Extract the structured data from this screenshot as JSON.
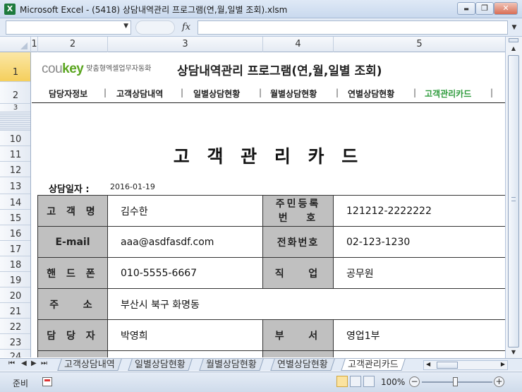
{
  "window": {
    "title": "Microsoft Excel - (5418) 상담내역관리 프로그램(연,월,일별 조회).xlsm",
    "app_icon": "excel-icon",
    "minimize_glyph": "▬",
    "restore_glyph": "❐",
    "close_glyph": "✕"
  },
  "formula_bar": {
    "name_box_value": "",
    "fx_label": "fx",
    "formula_value": ""
  },
  "columns": [
    "1",
    "2",
    "3",
    "4",
    "5"
  ],
  "rows": [
    "1",
    "2",
    "3",
    "10",
    "11",
    "12",
    "13",
    "14",
    "15",
    "16",
    "17",
    "18",
    "19",
    "20",
    "21",
    "22",
    "23",
    "24"
  ],
  "header": {
    "logo_cou": "cou",
    "logo_key": "key",
    "logo_tagline": "맞춤형엑셀업무자동화",
    "program_title": "상담내역관리 프로그램(연,월,일별 조회)"
  },
  "nav": {
    "items": [
      {
        "label": "담당자정보"
      },
      {
        "label": "고객상담내역"
      },
      {
        "label": "일별상담현황"
      },
      {
        "label": "월별상담현황"
      },
      {
        "label": "연별상담현황"
      },
      {
        "label": "고객관리카드"
      }
    ],
    "separator": "|",
    "current_index": 5
  },
  "card": {
    "title": "고 객 관 리 카 드",
    "date_label": "상담일자 :",
    "date_value": "2016-01-19",
    "rows": [
      {
        "l1": "고 객 명",
        "v1": "김수한",
        "l2a": "주민등록",
        "l2b": "번   호",
        "v2": "121212-2222222"
      },
      {
        "l1": "E-mail",
        "v1": "aaa@asdfasdf.com",
        "l2": "전화번호",
        "v2": "02-123-1230"
      },
      {
        "l1": "핸 드 폰",
        "v1": "010-5555-6667",
        "l2": "직   업",
        "v2": "공무원"
      },
      {
        "l1": "주   소",
        "v1": "부산시 북구 화명동"
      },
      {
        "l1": "담 당 자",
        "v1": "박영희",
        "l2": "부   서",
        "v2": "영업1부"
      }
    ]
  },
  "sheet_tabs": [
    {
      "label": "고객상담내역"
    },
    {
      "label": "일별상담현황"
    },
    {
      "label": "월별상담현황"
    },
    {
      "label": "연별상담현황"
    },
    {
      "label": "고객관리카드"
    }
  ],
  "active_sheet_index": 4,
  "status": {
    "ready": "준비",
    "zoom": "100%",
    "zoom_minus": "−",
    "zoom_plus": "+"
  }
}
